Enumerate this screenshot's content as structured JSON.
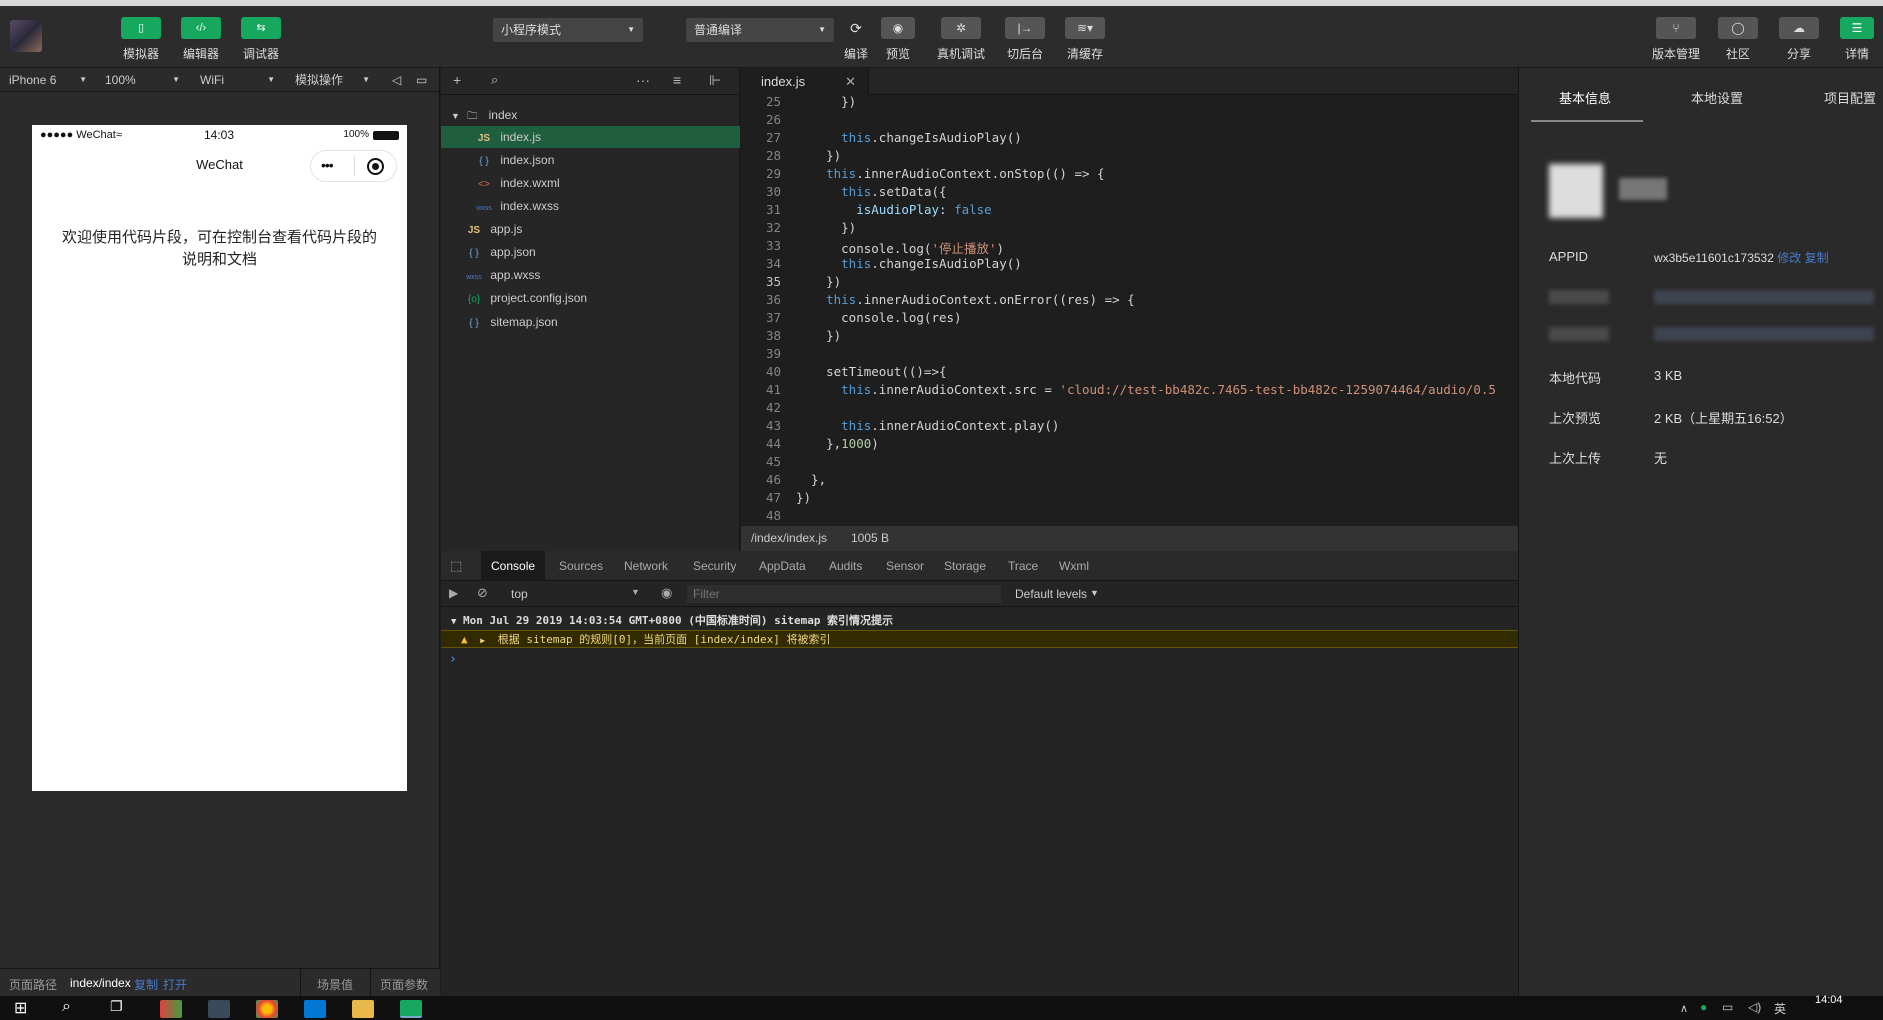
{
  "toolbar": {
    "simulator": "模拟器",
    "editor": "编辑器",
    "debugger": "调试器",
    "mode_select": "小程序模式",
    "compile_select": "普通编译",
    "compile": "编译",
    "preview": "预览",
    "remote_debug": "真机调试",
    "background": "切后台",
    "clear_cache": "清缓存",
    "version": "版本管理",
    "community": "社区",
    "share": "分享",
    "details": "详情"
  },
  "sim_bar": {
    "device": "iPhone 6",
    "zoom": "100%",
    "network": "WiFi",
    "simulate_op": "模拟操作"
  },
  "phone": {
    "carrier": "●●●●● WeChat",
    "time": "14:03",
    "battery": "100%",
    "title": "WeChat",
    "message": "欢迎使用代码片段，可在控制台查看代码片段的说明和文档"
  },
  "sim_footer": {
    "path_label": "页面路径",
    "path_value": "index/index",
    "copy": "复制",
    "open": "打开",
    "scene": "场景值",
    "params": "页面参数"
  },
  "tree": {
    "items": [
      {
        "name": "index",
        "icon": "folder-icon"
      },
      {
        "name": "index.js",
        "icon": "JS"
      },
      {
        "name": "index.json",
        "icon": "{ }"
      },
      {
        "name": "index.wxml",
        "icon": "<>"
      },
      {
        "name": "index.wxss",
        "icon": "wxss"
      },
      {
        "name": "app.js",
        "icon": "JS"
      },
      {
        "name": "app.json",
        "icon": "{ }"
      },
      {
        "name": "app.wxss",
        "icon": "wxss"
      },
      {
        "name": "project.config.json",
        "icon": "{o}"
      },
      {
        "name": "sitemap.json",
        "icon": "{ }"
      }
    ]
  },
  "editor": {
    "tab": "index.js",
    "file_path": "/index/index.js",
    "file_size": "1005 B"
  },
  "console": {
    "tabs": [
      "Console",
      "Sources",
      "Network",
      "Security",
      "AppData",
      "Audits",
      "Sensor",
      "Storage",
      "Trace",
      "Wxml"
    ],
    "context": "top",
    "filter_placeholder": "Filter",
    "levels": "Default levels",
    "log_header": "Mon Jul 29 2019 14:03:54 GMT+0800 (中国标准时间) sitemap 索引情况提示",
    "warning": "根据 sitemap 的规则[0]，当前页面 [index/index] 将被索引"
  },
  "right": {
    "tabs": [
      "基本信息",
      "本地设置",
      "项目配置"
    ],
    "appid_label": "APPID",
    "appid_value": "wx3b5e11601c173532",
    "modify": "修改",
    "copy": "复制",
    "local_code_label": "本地代码",
    "local_code_value": "3 KB",
    "last_preview_label": "上次预览",
    "last_preview_value": "2 KB（上星期五16:52）",
    "last_upload_label": "上次上传",
    "last_upload_value": "无"
  },
  "taskbar": {
    "time": "14:04",
    "lang": "英"
  }
}
